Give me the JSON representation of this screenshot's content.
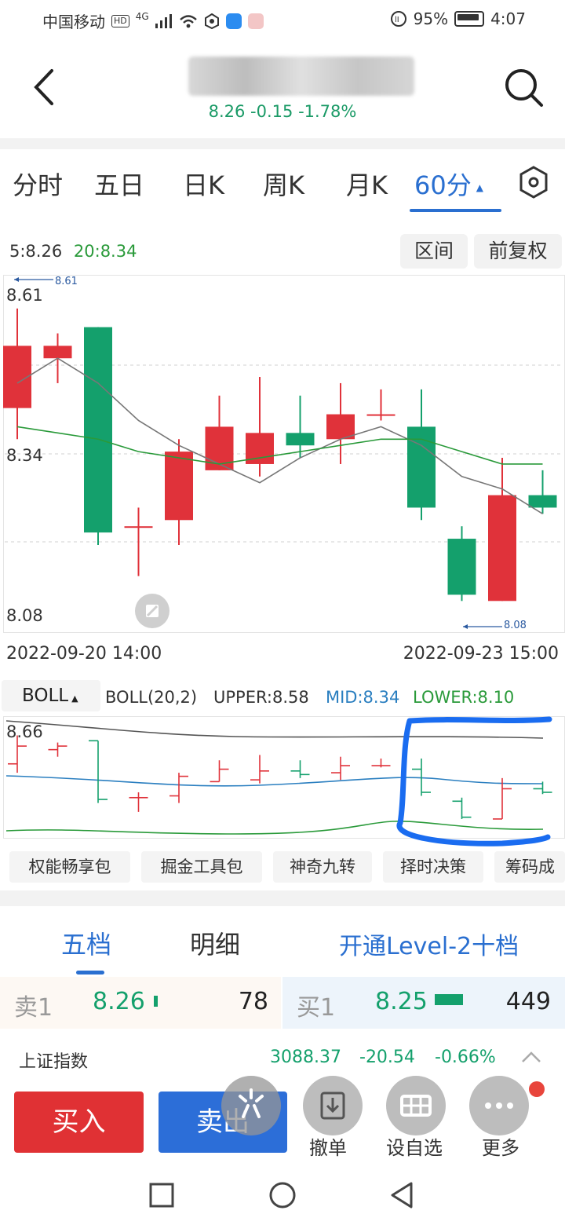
{
  "status": {
    "carrier": "中国移动",
    "hd": "HD",
    "net": "4G",
    "battery": "95%",
    "time": "4:07"
  },
  "header": {
    "quote": "8.26 -0.15 -1.78%"
  },
  "period_tabs": [
    "分时",
    "五日",
    "日K",
    "周K",
    "月K",
    "60分"
  ],
  "period_tab_arrow": "▲",
  "ma_legend": {
    "ma5": "5:8.26",
    "ma20": "20:8.34"
  },
  "chart_buttons": {
    "range": "区间",
    "adjust": "前复权"
  },
  "colors": {
    "up": "#e0323a",
    "down": "#14a06c",
    "ma5": "#777777",
    "ma20": "#2a9a3a",
    "accent": "#2a6fd0",
    "upper": "#555555",
    "mid": "#2b7fc0",
    "lower": "#2a9a3a",
    "annotation": "#1a6cf0"
  },
  "chart_data": {
    "type": "candlestick",
    "ylim": [
      8.08,
      8.61
    ],
    "y_labels": [
      "8.61",
      "8.34",
      "8.08"
    ],
    "max_label": "8.61",
    "min_label": "8.08",
    "x_start": "2022-09-20 14:00",
    "x_end": "2022-09-23 15:00",
    "candles": [
      {
        "o": 8.43,
        "c": 8.53,
        "h": 8.59,
        "l": 8.38
      },
      {
        "o": 8.51,
        "c": 8.53,
        "h": 8.55,
        "l": 8.47
      },
      {
        "o": 8.56,
        "c": 8.23,
        "h": 8.56,
        "l": 8.21
      },
      {
        "o": 8.24,
        "c": 8.24,
        "h": 8.27,
        "l": 8.16
      },
      {
        "o": 8.25,
        "c": 8.36,
        "h": 8.38,
        "l": 8.21
      },
      {
        "o": 8.33,
        "c": 8.4,
        "h": 8.45,
        "l": 8.33
      },
      {
        "o": 8.34,
        "c": 8.39,
        "h": 8.48,
        "l": 8.32
      },
      {
        "o": 8.39,
        "c": 8.37,
        "h": 8.45,
        "l": 8.35
      },
      {
        "o": 8.38,
        "c": 8.42,
        "h": 8.47,
        "l": 8.34
      },
      {
        "o": 8.42,
        "c": 8.42,
        "h": 8.46,
        "l": 8.41
      },
      {
        "o": 8.4,
        "c": 8.27,
        "h": 8.46,
        "l": 8.25
      },
      {
        "o": 8.22,
        "c": 8.13,
        "h": 8.24,
        "l": 8.12
      },
      {
        "o": 8.12,
        "c": 8.29,
        "h": 8.35,
        "l": 8.12
      },
      {
        "o": 8.29,
        "c": 8.27,
        "h": 8.33,
        "l": 8.26
      }
    ],
    "ma5": [
      8.47,
      8.51,
      8.47,
      8.41,
      8.37,
      8.34,
      8.31,
      8.35,
      8.38,
      8.4,
      8.37,
      8.32,
      8.3,
      8.26
    ],
    "ma20": [
      8.4,
      8.39,
      8.38,
      8.36,
      8.35,
      8.34,
      8.35,
      8.36,
      8.37,
      8.38,
      8.38,
      8.36,
      8.34,
      8.34
    ]
  },
  "boll": {
    "name": "BOLL",
    "params": "BOLL(20,2)",
    "upper": "UPPER:8.58",
    "mid": "MID:8.34",
    "lower": "LOWER:8.10",
    "axis_top": "8.66"
  },
  "tool_buttons": [
    "权能畅享包",
    "掘金工具包",
    "神奇九转",
    "择时决策",
    "筹码成"
  ],
  "order_tabs": {
    "five": "五档",
    "detail": "明细",
    "level2": "开通Level-2十档"
  },
  "orderbook": {
    "sell_label": "卖1",
    "sell_price": "8.26",
    "sell_vol": "78",
    "buy_label": "买1",
    "buy_price": "8.25",
    "buy_vol": "449"
  },
  "index": {
    "name": "上证指数",
    "value": "3088.37",
    "change": "-20.54",
    "pct": "-0.66%"
  },
  "bottom": {
    "buy": "买入",
    "sell": "卖出",
    "cancel": "撤单",
    "watch": "设自选",
    "more": "更多"
  }
}
